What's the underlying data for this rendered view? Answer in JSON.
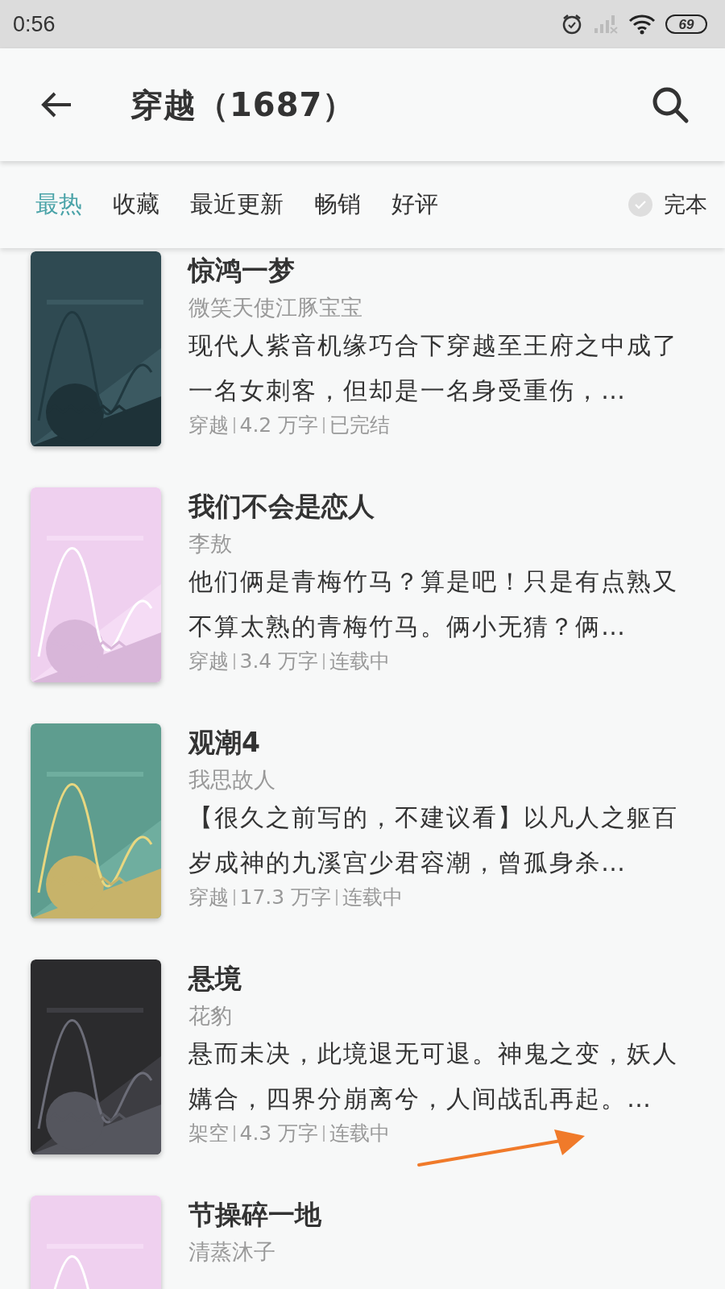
{
  "status_bar": {
    "time": "0:56",
    "battery": "69"
  },
  "app_bar": {
    "title": "穿越（1687）"
  },
  "tabs": [
    {
      "label": "最热",
      "selected": true
    },
    {
      "label": "收藏",
      "selected": false
    },
    {
      "label": "最近更新",
      "selected": false
    },
    {
      "label": "畅销",
      "selected": false
    },
    {
      "label": "好评",
      "selected": false
    }
  ],
  "filter": {
    "label": "完本",
    "checked": false
  },
  "books": [
    {
      "title": "惊鸿一梦",
      "author": "微笑天使江豚宝宝",
      "description": "现代人紫音机缘巧合下穿越至王府之中成了一名女刺客，但却是一名身受重伤，…",
      "meta": [
        "穿越",
        "4.2 万字",
        "已完结"
      ]
    },
    {
      "title": "我们不会是恋人",
      "author": "李敖",
      "description": "他们俩是青梅竹马？算是吧！只是有点熟又不算太熟的青梅竹马。俩小无猜？俩…",
      "meta": [
        "穿越",
        "3.4 万字",
        "连载中"
      ]
    },
    {
      "title": "观潮4",
      "author": "我思故人",
      "description": "【很久之前写的，不建议看】以凡人之躯百岁成神的九溪宫少君容潮，曾孤身杀…",
      "meta": [
        "穿越",
        "17.3 万字",
        "连载中"
      ]
    },
    {
      "title": "悬境",
      "author": "花豹",
      "description": "悬而未决，此境退无可退。神鬼之变，妖人媾合，四界分崩离兮，人间战乱再起。…",
      "meta": [
        "架空",
        "4.3 万字",
        "连载中"
      ]
    },
    {
      "title": "节操碎一地",
      "author": "清蒸沐子"
    }
  ]
}
